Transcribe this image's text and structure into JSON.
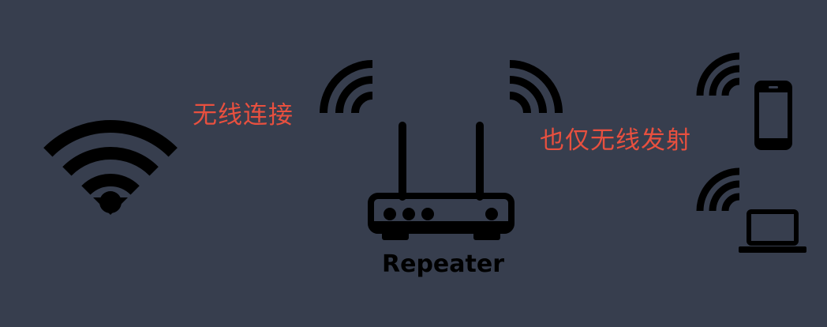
{
  "labels": {
    "wireless_connect": "无线连接",
    "wireless_transmit_only": "也仅无线发射",
    "repeater": "Repeater"
  },
  "colors": {
    "background": "#373e4e",
    "icon": "#000000",
    "label": "#e8503f"
  },
  "icons": {
    "source": "wifi-icon",
    "receive": "wifi-signal-left-icon",
    "transmit": "wifi-signal-right-icon",
    "device_repeater": "router-icon",
    "client_phone": "smartphone-icon",
    "client_laptop": "laptop-icon"
  }
}
